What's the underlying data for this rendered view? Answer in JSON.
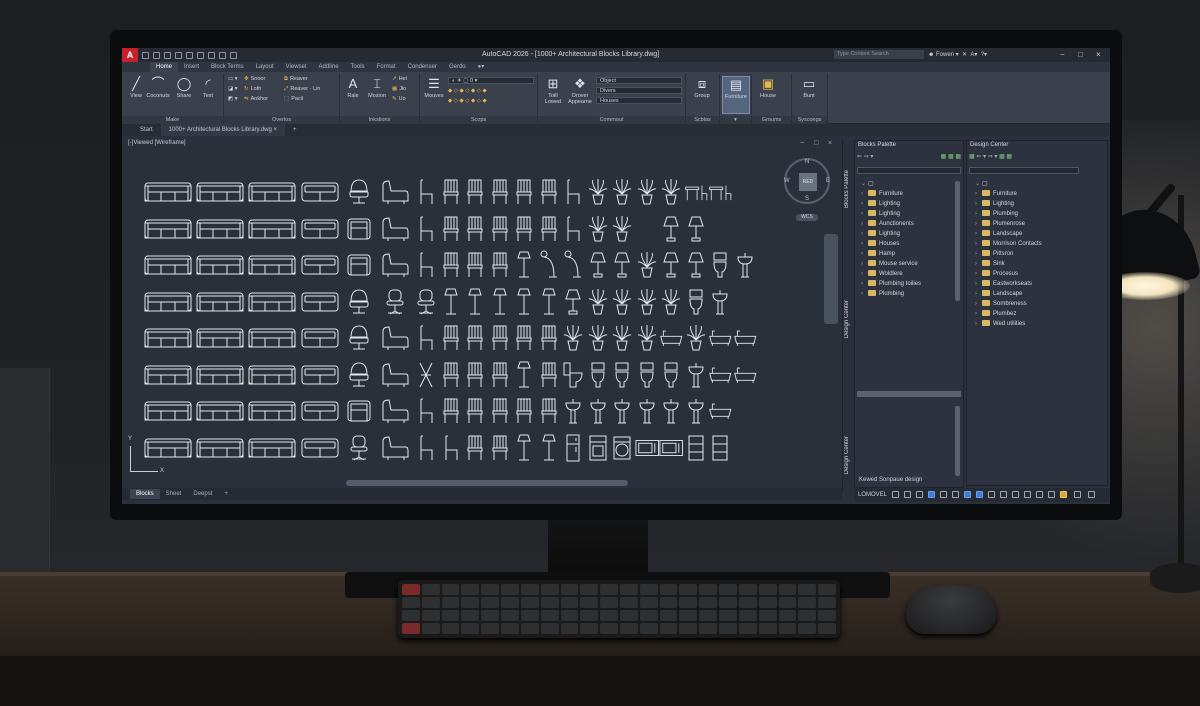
{
  "app": {
    "logo": "A",
    "title": "AutoCAD 2026 - [1000+ Architectural Blocks Library.dwg]",
    "search_placeholder": "Type Content Search",
    "sign_in": "Fowen",
    "window_controls": [
      "−",
      "□",
      "×"
    ]
  },
  "ribbon_tabs": [
    "Home",
    "Insert",
    "Block Terms",
    "Layout",
    "Viewset",
    "Addline",
    "Tools",
    "Format",
    "Condenser",
    "Gerdo"
  ],
  "ribbon": {
    "panels": [
      {
        "label": "Make",
        "tools": [
          "View",
          "Coconuts",
          "Share",
          "Text"
        ]
      },
      {
        "label": "Overlos",
        "small_tools": [
          "Snoor",
          "Loth",
          "Ankhor",
          "Reaver",
          "Reaver · Lin",
          "Pacil"
        ]
      },
      {
        "label": "Inkstions",
        "tools": [
          "Rale",
          "Mosion"
        ],
        "small_tools": [
          "Hei",
          "Jlo",
          "Uo"
        ]
      },
      {
        "label": "Scops",
        "tools": [
          "Mouves"
        ]
      },
      {
        "label": "Commout",
        "tools": [
          "Toill Lowed",
          "Orover Appearne"
        ],
        "dropdowns": [
          "Object",
          "Divers",
          "Houses"
        ]
      },
      {
        "label": "Scblas",
        "tools": [
          "Group"
        ]
      },
      {
        "label": "",
        "tools": [
          "Furniture"
        ]
      },
      {
        "label": "Groums",
        "tools": [
          "House"
        ]
      },
      {
        "label": "Syscongs",
        "tools": [
          "Bunt"
        ]
      }
    ]
  },
  "doc_tabs": [
    "Start",
    "1000+ Architectural Blocks Library.dwg"
  ],
  "viewport": {
    "label": "[-]Viewed [Wireframe]",
    "controls": [
      "−",
      "□",
      "×"
    ],
    "viewcube": {
      "face": "RED",
      "n": "N",
      "s": "S",
      "e": "E",
      "w": "W",
      "wcs": "WCS"
    },
    "ucs": {
      "x": "X",
      "y": "Y"
    }
  },
  "layout_tabs": [
    "Blocks",
    "Sheet",
    "Deepst",
    "+"
  ],
  "blocks_palette": {
    "side_tab": "Blocks Palette",
    "title": "Blocks Palette",
    "items": [
      "Furniture",
      "Lighting",
      "Lighting",
      "Aunctionents",
      "Lighting",
      "Houses",
      "Hamp",
      "Mouse service",
      "Woldlere",
      "Plumbing toilies",
      "Plumbing"
    ],
    "footer": "Kewed Sonpaue design"
  },
  "design_center": {
    "side_tab": "Design Center",
    "title": "Design Center",
    "items": [
      "Furniture",
      "Lighting",
      "Plumbing",
      "Plumenrose",
      "Landscape",
      "Morrison Contacts",
      "Pittsron",
      "Sink",
      "Procesus",
      "Eastworkseats",
      "Landscape",
      "Sombreness",
      "Plumbez",
      "Wed utilities"
    ]
  },
  "status": {
    "model": "LOMOVEL"
  },
  "colors": {
    "accent": "#c8202a",
    "folder": "#d9b864",
    "canvas": "#2a303a",
    "ribbon": "#3a414d"
  },
  "block_symbols": [
    [
      "sofa3",
      "sofa3",
      "sofa3",
      "sofa2",
      "armchair-round",
      "armchair-side",
      "chair-side",
      "chair-front",
      "chair-front",
      "chair-front",
      "chair-front",
      "chair-front",
      "chair-side",
      "plant",
      "plant",
      "plant",
      "plant",
      "desk-chair",
      "desk-chair",
      "blank"
    ],
    [
      "sofa3",
      "sofa3",
      "sofa3",
      "sofa2",
      "armchair",
      "armchair-side",
      "chair-side",
      "chair-front",
      "chair-front",
      "chair-front",
      "chair-front",
      "chair-front",
      "chair-side",
      "plant",
      "plant",
      "blank",
      "lamp-table",
      "lamp-table",
      "blank",
      "blank"
    ],
    [
      "sofa3",
      "sofa3",
      "sofa3",
      "sofa2",
      "armchair",
      "armchair-side",
      "chair-side",
      "chair-front",
      "chair-front",
      "chair-front",
      "lamp-floor",
      "lamp-arc",
      "lamp-arc",
      "lamp-table",
      "lamp-table",
      "plant",
      "lamp-table",
      "lamp-table",
      "toilet",
      "sink"
    ],
    [
      "sofa3",
      "sofa3",
      "sofa3",
      "sofa2",
      "armchair-round",
      "office-chair",
      "office-chair",
      "lamp-floor",
      "lamp-floor",
      "lamp-floor",
      "lamp-floor",
      "lamp-floor",
      "lamp-table",
      "plant",
      "plant",
      "plant",
      "plant",
      "toilet",
      "sink",
      "blank"
    ],
    [
      "sofa3",
      "sofa3",
      "sofa3",
      "sofa2",
      "armchair-round",
      "armchair-side",
      "chair-side",
      "chair-front",
      "chair-front",
      "chair-front",
      "chair-front",
      "chair-front",
      "plant",
      "plant",
      "plant",
      "plant",
      "bathtub",
      "plant",
      "bathtub",
      "bathtub"
    ],
    [
      "sofa3",
      "sofa3",
      "sofa3",
      "sofa2",
      "armchair-round",
      "armchair-side",
      "chair-fold",
      "chair-front",
      "chair-front",
      "chair-front",
      "lamp-floor",
      "chair-front",
      "toilet-side",
      "toilet",
      "toilet",
      "toilet",
      "toilet",
      "sink",
      "bathtub",
      "bathtub"
    ],
    [
      "sofa3",
      "sofa3",
      "sofa3",
      "sofa2",
      "armchair",
      "armchair-side",
      "chair-side",
      "chair-front",
      "chair-front",
      "chair-front",
      "chair-front",
      "chair-front",
      "sink",
      "sink",
      "sink",
      "sink",
      "sink",
      "sink",
      "bathtub",
      "blank"
    ],
    [
      "sofa3",
      "sofa3",
      "sofa3",
      "sofa2",
      "office-chair",
      "armchair-side",
      "chair-side",
      "chair-side",
      "chair-front",
      "chair-front",
      "lamp-floor",
      "lamp-floor",
      "fridge",
      "stove",
      "washer",
      "microwave",
      "microwave",
      "cabinet",
      "cabinet",
      "blank"
    ]
  ]
}
